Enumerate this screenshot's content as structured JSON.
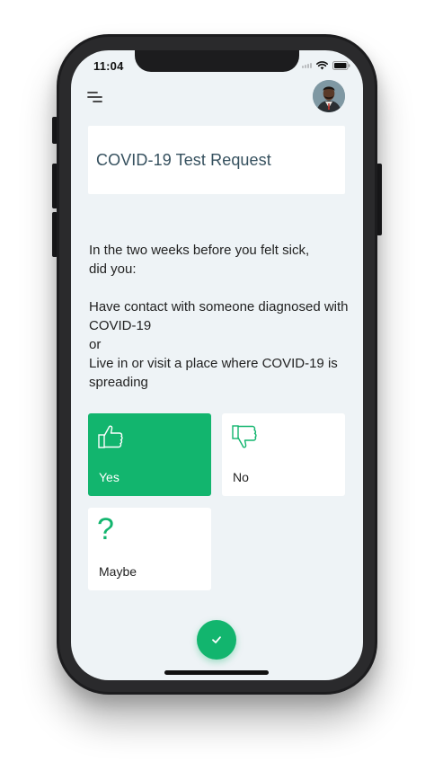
{
  "status": {
    "time": "11:04",
    "icons": [
      "signal-icon",
      "wifi-icon",
      "battery-icon"
    ]
  },
  "header": {
    "menu_icon": "menu-icon",
    "avatar": "user-avatar"
  },
  "title": "COVID-19 Test Request",
  "question": "In the two weeks before you felt sick,\ndid you:\n\nHave contact with someone diagnosed with COVID-19\n or\nLive in or visit a place where COVID-19 is spreading",
  "options": [
    {
      "label": "Yes",
      "icon": "thumbs-up-icon",
      "selected": true
    },
    {
      "label": "No",
      "icon": "thumbs-down-icon",
      "selected": false
    },
    {
      "label": "Maybe",
      "icon": "question-mark-icon",
      "selected": false
    }
  ],
  "maybe_glyph": "?",
  "submit_icon": "checkmark-icon",
  "colors": {
    "accent": "#12b56e",
    "background": "#eef3f6",
    "title": "#35505e"
  }
}
